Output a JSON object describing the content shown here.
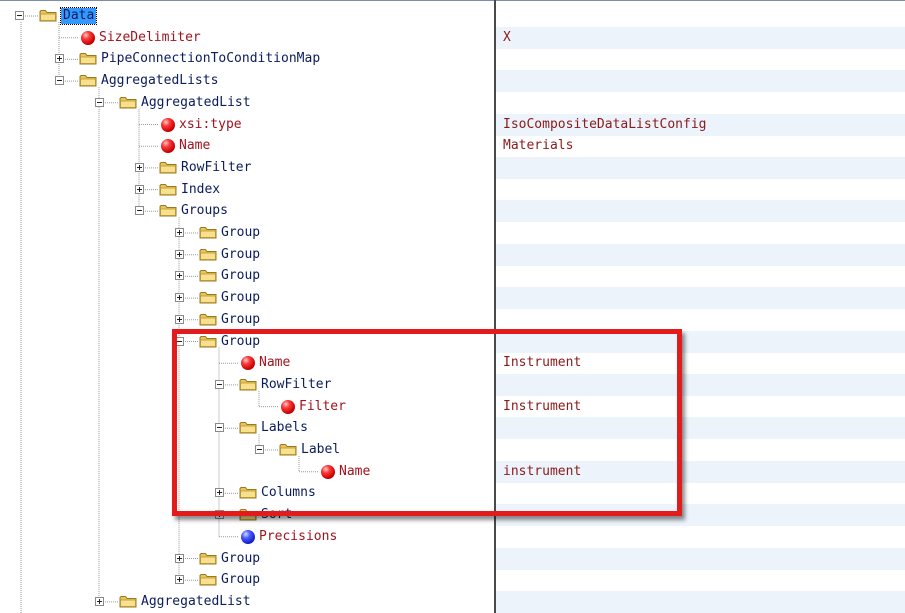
{
  "tree": {
    "rows": [
      {
        "label": "Data",
        "icon": "folder-icon",
        "expander": "minus",
        "value": "",
        "selected": true
      },
      {
        "label": "SizeDelimiter",
        "icon": "attribute-icon",
        "value": "X"
      },
      {
        "label": "PipeConnectionToConditionMap",
        "icon": "folder-icon",
        "expander": "plus",
        "value": ""
      },
      {
        "label": "AggregatedLists",
        "icon": "folder-icon",
        "expander": "minus",
        "value": ""
      },
      {
        "label": "AggregatedList",
        "icon": "folder-icon",
        "expander": "minus",
        "value": ""
      },
      {
        "label": "xsi:type",
        "icon": "attribute-icon",
        "value": "IsoCompositeDataListConfig"
      },
      {
        "label": "Name",
        "icon": "attribute-icon",
        "value": "Materials"
      },
      {
        "label": "RowFilter",
        "icon": "folder-icon",
        "expander": "plus",
        "value": ""
      },
      {
        "label": "Index",
        "icon": "folder-icon",
        "expander": "plus",
        "value": ""
      },
      {
        "label": "Groups",
        "icon": "folder-icon",
        "expander": "minus",
        "value": ""
      },
      {
        "label": "Group",
        "icon": "folder-icon",
        "expander": "plus",
        "value": ""
      },
      {
        "label": "Group",
        "icon": "folder-icon",
        "expander": "plus",
        "value": ""
      },
      {
        "label": "Group",
        "icon": "folder-icon",
        "expander": "plus",
        "value": ""
      },
      {
        "label": "Group",
        "icon": "folder-icon",
        "expander": "plus",
        "value": ""
      },
      {
        "label": "Group",
        "icon": "folder-icon",
        "expander": "plus",
        "value": ""
      },
      {
        "label": "Group",
        "icon": "folder-icon",
        "expander": "minus",
        "value": ""
      },
      {
        "label": "Name",
        "icon": "attribute-icon",
        "value": "Instrument"
      },
      {
        "label": "RowFilter",
        "icon": "folder-icon",
        "expander": "minus",
        "value": ""
      },
      {
        "label": "Filter",
        "icon": "attribute-icon",
        "value": "Instrument"
      },
      {
        "label": "Labels",
        "icon": "folder-icon",
        "expander": "minus",
        "value": ""
      },
      {
        "label": "Label",
        "icon": "folder-icon",
        "expander": "minus",
        "value": ""
      },
      {
        "label": "Name",
        "icon": "attribute-icon",
        "value": "instrument"
      },
      {
        "label": "Columns",
        "icon": "folder-icon",
        "expander": "plus",
        "value": ""
      },
      {
        "label": "Sort",
        "icon": "folder-icon",
        "expander": "plus",
        "value": ""
      },
      {
        "label": "Precisions",
        "icon": "element-icon",
        "value": ""
      },
      {
        "label": "Group",
        "icon": "folder-icon",
        "expander": "plus",
        "value": ""
      },
      {
        "label": "Group",
        "icon": "folder-icon",
        "expander": "plus",
        "value": ""
      },
      {
        "label": "AggregatedList",
        "icon": "folder-icon",
        "expander": "plus",
        "value": ""
      }
    ]
  },
  "colors": {
    "highlight_border": "#e31b1b",
    "selection": "#3399ff",
    "folder_label": "#0b1c5c",
    "attribute_label": "#a0141e",
    "value_text": "#8b1a1a"
  }
}
